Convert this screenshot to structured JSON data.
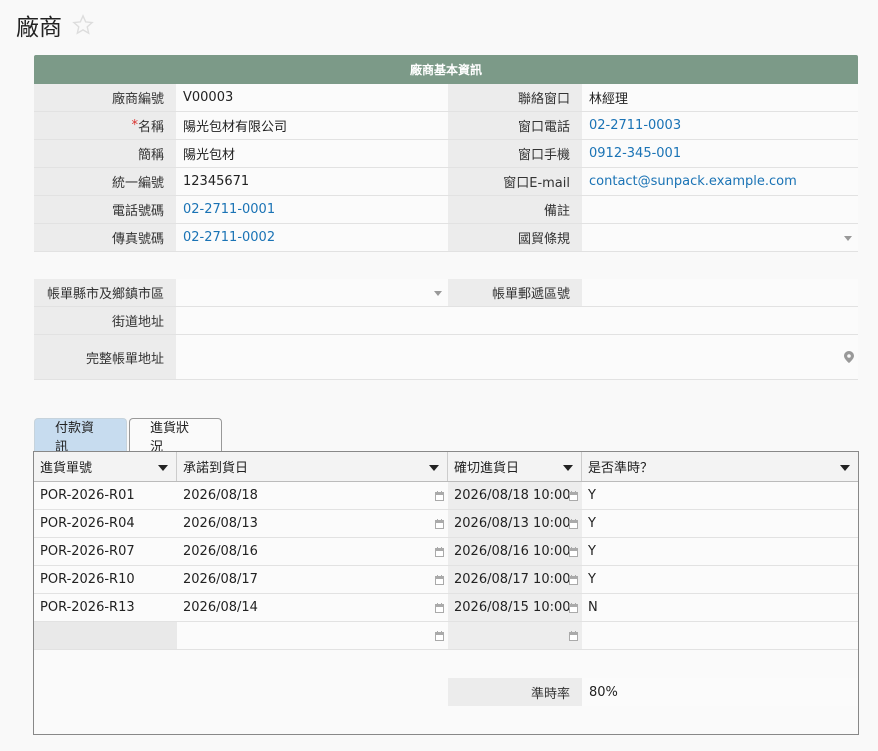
{
  "page": {
    "title": "廠商"
  },
  "section": {
    "title": "廠商基本資訊"
  },
  "basic_rows": [
    {
      "label1": "廠商編號",
      "value1": "V00003",
      "label2": "聯絡窗口",
      "value2": "林經理"
    },
    {
      "label1": "名稱",
      "required_mark": "*",
      "value1": "陽光包材有限公司",
      "label2": "窗口電話",
      "value2": "02-2711-0003"
    },
    {
      "label1": "簡稱",
      "value1": "陽光包材",
      "label2": "窗口手機",
      "value2": "0912-345-001"
    },
    {
      "label1": "統一編號",
      "value1": "12345671",
      "label2": "窗口E-mail",
      "value2": "contact@sunpack.example.com"
    },
    {
      "label1": "電話號碼",
      "value1": "02-2711-0001",
      "label2": "備註",
      "value2": ""
    },
    {
      "label1": "傳真號碼",
      "value1": "02-2711-0002",
      "label2": "國貿條規",
      "value2": ""
    }
  ],
  "address": {
    "city_label": "帳單縣市及鄉鎮市區",
    "city_value": "",
    "zip_label": "帳單郵遞區號",
    "zip_value": "",
    "street_label": "街道地址",
    "street_value": "",
    "full_label": "完整帳單地址",
    "full_value": ""
  },
  "tabs": [
    {
      "label": "付款資訊",
      "active": true
    },
    {
      "label": "進貨狀況",
      "active": false
    }
  ],
  "table": {
    "columns": [
      "進貨單號",
      "承諾到貨日",
      "確切進貨日",
      "是否準時？"
    ],
    "rows": [
      {
        "order": "POR-2026-R01",
        "promised": "2026/08/18",
        "actual": "2026/08/18 10:00",
        "on_time": "Y"
      },
      {
        "order": "POR-2026-R04",
        "promised": "2026/08/13",
        "actual": "2026/08/13 10:00",
        "on_time": "Y"
      },
      {
        "order": "POR-2026-R07",
        "promised": "2026/08/16",
        "actual": "2026/08/16 10:00",
        "on_time": "Y"
      },
      {
        "order": "POR-2026-R10",
        "promised": "2026/08/17",
        "actual": "2026/08/17 10:00",
        "on_time": "Y"
      },
      {
        "order": "POR-2026-R13",
        "promised": "2026/08/14",
        "actual": "2026/08/15 10:00",
        "on_time": "N"
      }
    ],
    "summary_label": "準時率",
    "summary_value": "80%"
  },
  "colors": {
    "section_header": "#7c9a88",
    "link": "#1a73b5",
    "required": "#d9302c",
    "active_tab": "#c7dcef"
  },
  "icons": [
    "star-outline-icon",
    "dropdown-arrow-icon",
    "map-pin-icon",
    "calendar-icon",
    "sort-dropdown-icon"
  ]
}
